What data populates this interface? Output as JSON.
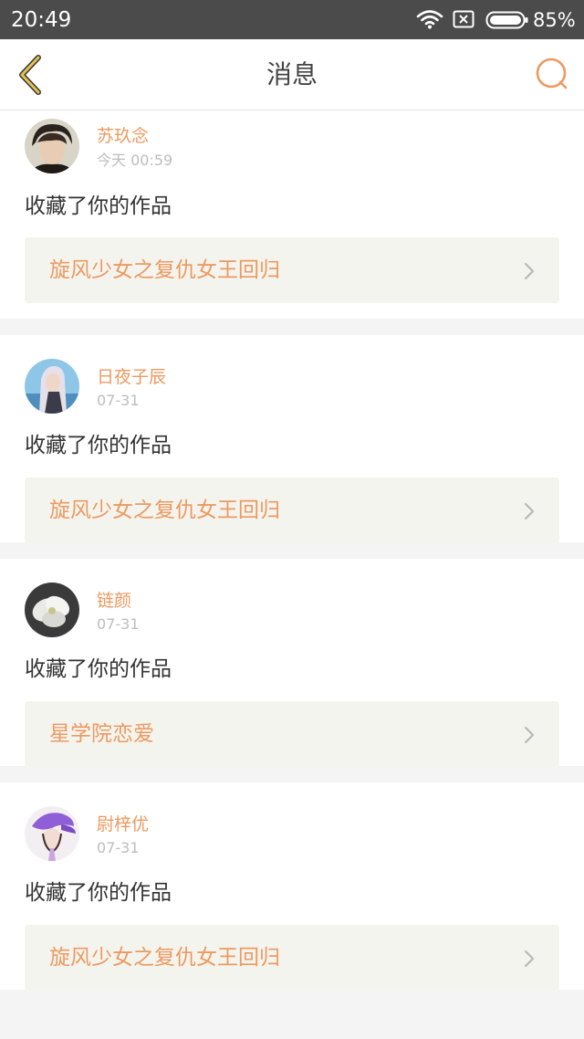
{
  "status_bar": {
    "time": "20:49",
    "battery_text": "85%",
    "icons": [
      "wifi-icon",
      "no-sim-icon",
      "battery-icon"
    ]
  },
  "nav": {
    "title": "消息",
    "back_icon": "back-chevron-icon",
    "search_icon": "search-icon"
  },
  "colors": {
    "accent": "#ec9a61",
    "status_bar_bg": "#4b4b4b",
    "card_bg": "#ffffff",
    "work_bg": "#f4f4ee",
    "back_icon": "#e3c24c"
  },
  "messages": [
    {
      "user": "苏玖念",
      "time": "今天 00:59",
      "action": "收藏了你的作品",
      "work": "旋风少女之复仇女王回归"
    },
    {
      "user": "日夜子辰",
      "time": "07-31",
      "action": "收藏了你的作品",
      "work": "旋风少女之复仇女王回归"
    },
    {
      "user": "链颜",
      "time": "07-31",
      "action": "收藏了你的作品",
      "work": "星学院恋爱"
    },
    {
      "user": "尉梓优",
      "time": "07-31",
      "action": "收藏了你的作品",
      "work": "旋风少女之复仇女王回归"
    }
  ]
}
